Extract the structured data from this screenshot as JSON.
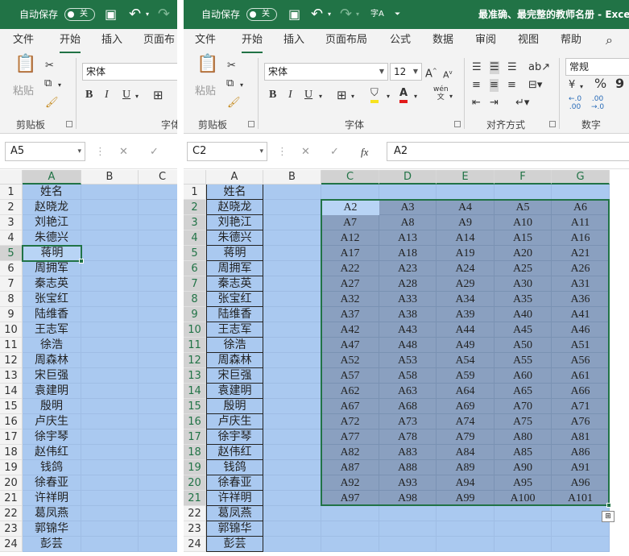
{
  "left": {
    "autosave_label": "自动保存",
    "toggle_label": "关",
    "menus": [
      "文件",
      "开始",
      "插入",
      "页面布"
    ],
    "font_name": "宋体",
    "paste_label": "粘贴",
    "groups": {
      "clipboard": "剪贴板",
      "font": "字体"
    },
    "name_box": "A5",
    "col_headers": [
      "A",
      "B",
      "C"
    ],
    "selected_col": "A",
    "active_row": 5
  },
  "right": {
    "autosave_label": "自动保存",
    "toggle_label": "关",
    "sort_label": "字A",
    "doc_title": "最准确、最完整的教师名册 - Exce",
    "menus": [
      "文件",
      "开始",
      "插入",
      "页面布局",
      "公式",
      "数据",
      "审阅",
      "视图",
      "帮助"
    ],
    "font_name": "宋体",
    "font_size": "12",
    "number_format": "常规",
    "paste_label": "粘贴",
    "groups": {
      "clipboard": "剪贴板",
      "font": "字体",
      "align": "对齐方式",
      "number": "数字"
    },
    "name_box": "C2",
    "formula": "A2",
    "col_headers": [
      "A",
      "B",
      "C",
      "D",
      "E",
      "F",
      "G"
    ]
  },
  "icons": {
    "undo": "↶",
    "redo": "↷",
    "save": "save-icon",
    "cut": "✂",
    "copy": "⧉",
    "brush": "🖌",
    "fx": "fx",
    "cancel": "✕",
    "enter": "✓",
    "percent": "%",
    "currency": "¥",
    "comma": "9",
    "inc_dec": "←.0\n.00",
    "dec_dec": ".00\n→.0",
    "search": "⌕"
  },
  "colors": {
    "excel_green": "#217346",
    "selection_fill": "#8aa0c0",
    "column_fill": "#aac9f0"
  },
  "rows": [
    "1",
    "2",
    "3",
    "4",
    "5",
    "6",
    "7",
    "8",
    "9",
    "10",
    "11",
    "12",
    "13",
    "14",
    "15",
    "16",
    "17",
    "18",
    "19",
    "20",
    "21",
    "22",
    "23",
    "24"
  ],
  "names": [
    "姓名",
    "赵晓龙",
    "刘艳江",
    "朱德兴",
    "蒋明",
    "周拥军",
    "秦志英",
    "张宝红",
    "陆维香",
    "王志军",
    "徐浩",
    "周森林",
    "宋巨强",
    "袁建明",
    "殷明",
    "卢庆生",
    "徐宇琴",
    "赵伟红",
    "钱鸽",
    "徐春亚",
    "许祥明",
    "葛凤燕",
    "郭锦华",
    "彭芸"
  ],
  "matrix": [
    [
      "A2",
      "A3",
      "A4",
      "A5",
      "A6"
    ],
    [
      "A7",
      "A8",
      "A9",
      "A10",
      "A11"
    ],
    [
      "A12",
      "A13",
      "A14",
      "A15",
      "A16"
    ],
    [
      "A17",
      "A18",
      "A19",
      "A20",
      "A21"
    ],
    [
      "A22",
      "A23",
      "A24",
      "A25",
      "A26"
    ],
    [
      "A27",
      "A28",
      "A29",
      "A30",
      "A31"
    ],
    [
      "A32",
      "A33",
      "A34",
      "A35",
      "A36"
    ],
    [
      "A37",
      "A38",
      "A39",
      "A40",
      "A41"
    ],
    [
      "A42",
      "A43",
      "A44",
      "A45",
      "A46"
    ],
    [
      "A47",
      "A48",
      "A49",
      "A50",
      "A51"
    ],
    [
      "A52",
      "A53",
      "A54",
      "A55",
      "A56"
    ],
    [
      "A57",
      "A58",
      "A59",
      "A60",
      "A61"
    ],
    [
      "A62",
      "A63",
      "A64",
      "A65",
      "A66"
    ],
    [
      "A67",
      "A68",
      "A69",
      "A70",
      "A71"
    ],
    [
      "A72",
      "A73",
      "A74",
      "A75",
      "A76"
    ],
    [
      "A77",
      "A78",
      "A79",
      "A80",
      "A81"
    ],
    [
      "A82",
      "A83",
      "A84",
      "A85",
      "A86"
    ],
    [
      "A87",
      "A88",
      "A89",
      "A90",
      "A91"
    ],
    [
      "A92",
      "A93",
      "A94",
      "A95",
      "A96"
    ],
    [
      "A97",
      "A98",
      "A99",
      "A100",
      "A101"
    ]
  ]
}
